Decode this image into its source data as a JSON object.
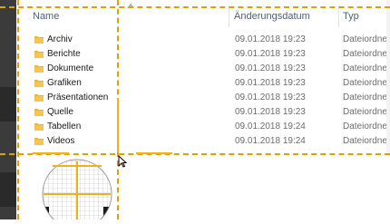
{
  "header": {
    "name_label": "Name",
    "date_label": "Änderungsdatum",
    "type_label": "Typ",
    "sort_icon": "caret-up-icon"
  },
  "rows": [
    {
      "name": "Archiv",
      "date": "09.01.2018 19:23",
      "type": "Dateiordner"
    },
    {
      "name": "Berichte",
      "date": "09.01.2018 19:23",
      "type": "Dateiordner"
    },
    {
      "name": "Dokumente",
      "date": "09.01.2018 19:23",
      "type": "Dateiordner"
    },
    {
      "name": "Grafiken",
      "date": "09.01.2018 19:23",
      "type": "Dateiordner"
    },
    {
      "name": "Präsentationen",
      "date": "09.01.2018 19:23",
      "type": "Dateiordner"
    },
    {
      "name": "Quelle",
      "date": "09.01.2018 19:23",
      "type": "Dateiordner"
    },
    {
      "name": "Tabellen",
      "date": "09.01.2018 19:24",
      "type": "Dateiordner"
    },
    {
      "name": "Videos",
      "date": "09.01.2018 19:24",
      "type": "Dateiordner"
    }
  ],
  "colors": {
    "guide": "#e0a100",
    "folder": "#e8b73f",
    "header_text": "#4c607a"
  }
}
